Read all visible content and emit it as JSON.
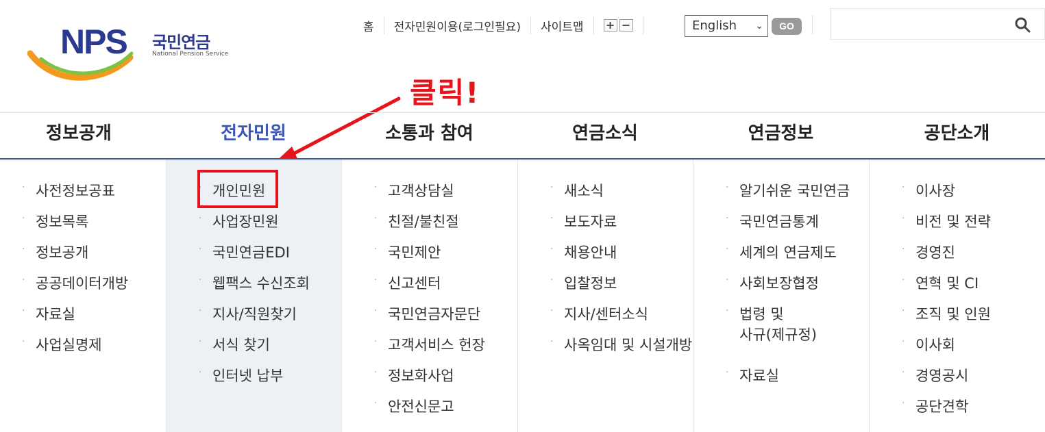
{
  "logo": {
    "mark": "NPS",
    "korean": "국민연금",
    "english": "National Pension Service"
  },
  "util": {
    "home": "홈",
    "e_service": "전자민원이용(로그인필요)",
    "sitemap": "사이트맵",
    "zoom_in": "+",
    "zoom_out": "−",
    "language": "English",
    "go": "GO"
  },
  "search": {
    "placeholder": ""
  },
  "callout": "클릭!",
  "nav": [
    {
      "label": "정보공개",
      "items": [
        "사전정보공표",
        "정보목록",
        "정보공개",
        "공공데이터개방",
        "자료실",
        "사업실명제"
      ]
    },
    {
      "label": "전자민원",
      "items": [
        "개인민원",
        "사업장민원",
        "국민연금EDI",
        "웹팩스 수신조회",
        "지사/직원찾기",
        "서식 찾기",
        "인터넷 납부"
      ]
    },
    {
      "label": "소통과 참여",
      "items": [
        "고객상담실",
        "친절/불친절",
        "국민제안",
        "신고센터",
        "국민연금자문단",
        "고객서비스 헌장",
        "정보화사업",
        "안전신문고"
      ]
    },
    {
      "label": "연금소식",
      "items": [
        "새소식",
        "보도자료",
        "채용안내",
        "입찰정보",
        "지사/센터소식",
        "사옥임대 및 시설개방"
      ]
    },
    {
      "label": "연금정보",
      "items": [
        "알기쉬운 국민연금",
        "국민연금통계",
        "세계의 연금제도",
        "사회보장협정",
        "법령 및",
        "사규(제규정)",
        "자료실"
      ]
    },
    {
      "label": "공단소개",
      "items": [
        "이사장",
        "비전 및 전략",
        "경영진",
        "연혁 및 CI",
        "조직 및 인원",
        "이사회",
        "경영공시",
        "공단견학"
      ]
    }
  ],
  "colors": {
    "brand": "#2b3a8f",
    "active": "#3b55b8",
    "accent_red": "#e3141b",
    "panel": "#edf1f5"
  }
}
